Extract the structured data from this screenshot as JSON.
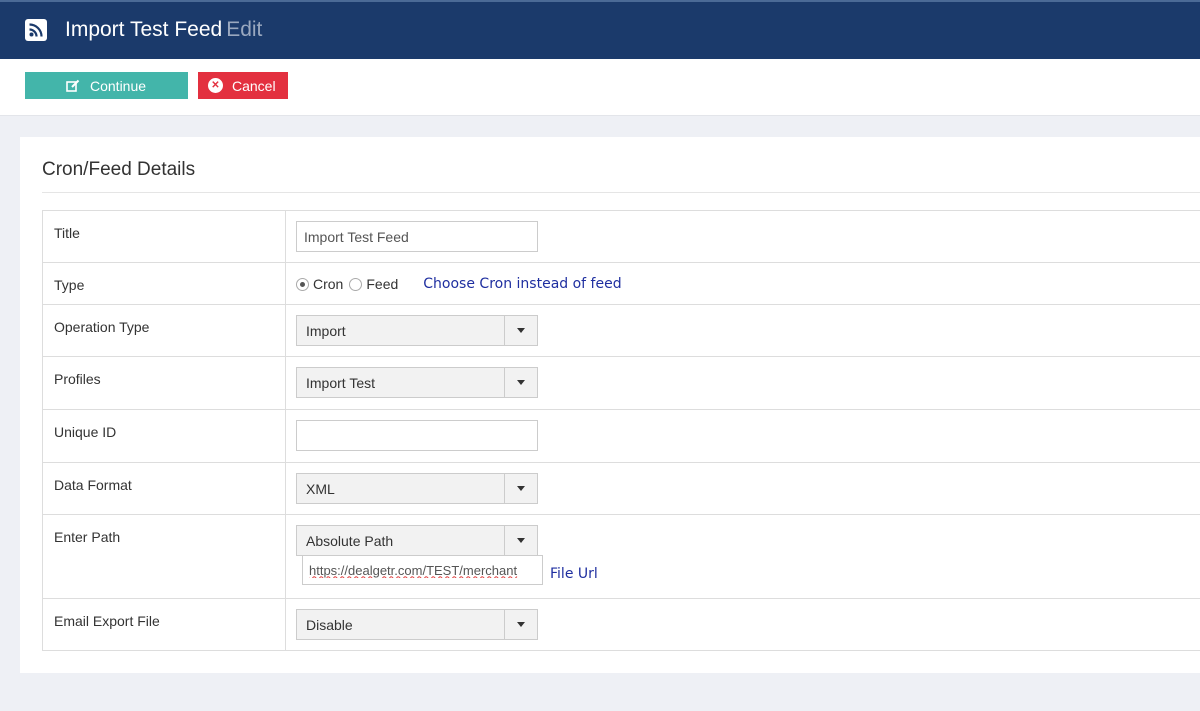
{
  "header": {
    "title": "Import Test Feed",
    "subtitle": "Edit"
  },
  "toolbar": {
    "continue_label": "Continue",
    "cancel_label": "Cancel"
  },
  "panel": {
    "title": "Cron/Feed Details"
  },
  "form": {
    "title": {
      "label": "Title",
      "value": "Import Test Feed"
    },
    "type": {
      "label": "Type",
      "options": [
        "Cron",
        "Feed"
      ],
      "selected": "Cron",
      "note": "Choose Cron instead of feed"
    },
    "operation_type": {
      "label": "Operation Type",
      "value": "Import"
    },
    "profiles": {
      "label": "Profiles",
      "value": "Import Test"
    },
    "unique_id": {
      "label": "Unique ID",
      "value": ""
    },
    "data_format": {
      "label": "Data Format",
      "value": "XML"
    },
    "enter_path": {
      "label": "Enter Path",
      "value": "Absolute Path",
      "url_value": "https://dealgetr.com/TEST/merchant",
      "url_note": "File Url"
    },
    "email_export": {
      "label": "Email Export File",
      "value": "Disable"
    }
  },
  "colors": {
    "header_bg": "#1b3a6b",
    "continue_bg": "#43b5aa",
    "cancel_bg": "#e3303f",
    "note_text": "#1f2fa0"
  }
}
